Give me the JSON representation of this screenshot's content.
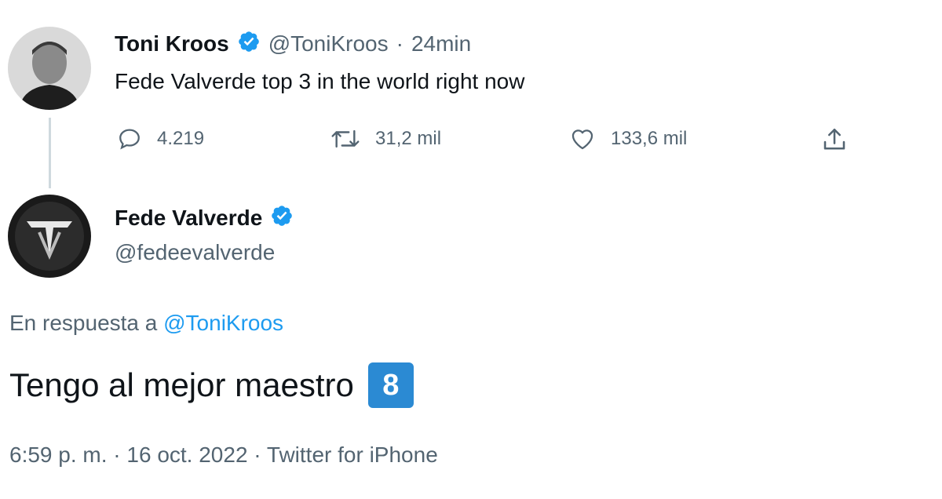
{
  "tweet1": {
    "author_name": "Toni Kroos",
    "handle": "@ToniKroos",
    "separator": "·",
    "time": "24min",
    "text": "Fede Valverde top 3 in the world right now",
    "actions": {
      "replies": "4.219",
      "retweets": "31,2 mil",
      "likes": "133,6 mil"
    },
    "icons": [
      "reply-icon",
      "retweet-icon",
      "like-icon",
      "share-icon",
      "verified-badge-icon"
    ]
  },
  "tweet2": {
    "author_name": "Fede Valverde",
    "handle": "@fedeevalverde",
    "reply_prefix": "En respuesta a",
    "reply_mention": "@ToniKroos",
    "text": "Tengo al mejor maestro",
    "emoji_keycap": "8",
    "meta": "6:59 p. m. · 16 oct. 2022 · Twitter for iPhone"
  },
  "colors": {
    "verified": "#1d9bf0",
    "link": "#1d9bf0",
    "secondary_text": "#536471",
    "primary_text": "#0f1419",
    "keycap_bg": "#2b8ad3"
  }
}
